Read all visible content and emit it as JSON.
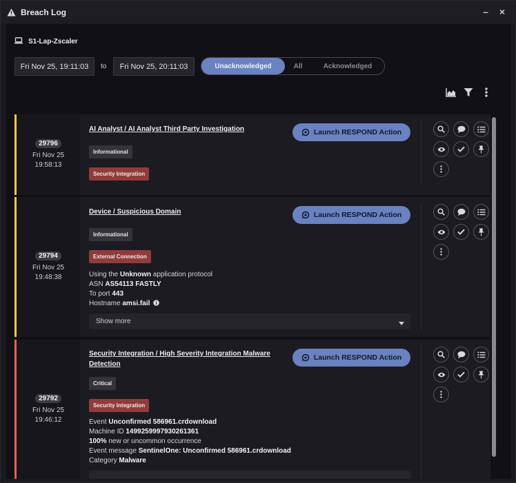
{
  "window": {
    "title": "Breach Log",
    "minimize_label": "–",
    "close_label": "×"
  },
  "host": {
    "name": "S1-Lap-Zscaler"
  },
  "filters": {
    "date_from": "Fri Nov 25, 19:11:03",
    "to_label": "to",
    "date_to": "Fri Nov 25, 20:11:03",
    "tabs": [
      "Unacknowledged",
      "All",
      "Acknowledged"
    ],
    "active_tab": "Unacknowledged"
  },
  "toolbar": {
    "icons": [
      "chart-icon",
      "filter-icon",
      "more-vertical-icon"
    ]
  },
  "colors": {
    "accent": "#6a82c0",
    "stripe_informational": "#f2c94c",
    "stripe_critical": "#e8615a",
    "tag_red": "#8f3c3b"
  },
  "breaches": [
    {
      "id": "29796",
      "date": "Fri Nov 25",
      "time": "19:58:13",
      "title": "AI Analyst / AI Analyst Third Party Investigation",
      "severity": "Informational",
      "category": "Security Integration",
      "launch_label": "Launch RESPOND Action"
    },
    {
      "id": "29794",
      "date": "Fri Nov 25",
      "time": "19:48:38",
      "title": "Device / Suspicious Domain",
      "severity": "Informational",
      "category": "External Connection",
      "launch_label": "Launch RESPOND Action",
      "details": {
        "line1_a": "Using the ",
        "line1_b": "Unknown",
        "line1_c": " application protocol",
        "line2_a": "ASN ",
        "line2_b": "AS54113 FASTLY",
        "line3_a": "To port ",
        "line3_b": "443",
        "line4_a": "Hostname ",
        "line4_b": "amsi.fail"
      },
      "show_more": "Show more"
    },
    {
      "id": "29792",
      "date": "Fri Nov 25",
      "time": "19:46:12",
      "title_line1": "Security Integration / High Severity Integration Malware",
      "title_line2": "Detection",
      "severity": "Critical",
      "category": "Security Integration",
      "launch_label": "Launch RESPOND Action",
      "details": {
        "line1_a": "Event ",
        "line1_b": "Unconfirmed 586961.crdownload",
        "line2_a": "Machine ID ",
        "line2_b": "1499259997930261361",
        "line3_a": "100%",
        "line3_b": " new or uncommon occurrence",
        "line4_a": "Event message ",
        "line4_b": "SentinelOne: Unconfirmed 586961.crdownload",
        "line5_a": "Category ",
        "line5_b": "Malware"
      }
    }
  ]
}
